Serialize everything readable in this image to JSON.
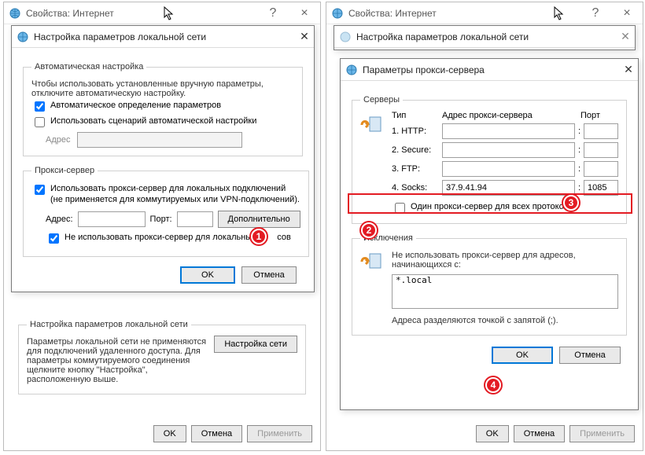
{
  "left": {
    "parentTitle": "Свойства: Интернет",
    "lanTitle": "Настройка параметров локальной сети",
    "auto": {
      "legend": "Автоматическая настройка",
      "desc": "Чтобы использовать установленные вручную параметры, отключите автоматическую настройку.",
      "autoDetect": "Автоматическое определение параметров",
      "useScript": "Использовать сценарий автоматической настройки",
      "addressLabel": "Адрес"
    },
    "proxy": {
      "legend": "Прокси-сервер",
      "useProxy": "Использовать прокси-сервер для локальных подключений (не применяется для коммутируемых или VPN-подключений).",
      "addressLabel": "Адрес:",
      "addressValue": "",
      "portLabel": "Порт:",
      "portValue": "",
      "advancedBtn": "Дополнительно",
      "bypassLocal": "Не использовать прокси-сервер для локальны",
      "bypassLocalSuffix": "сов"
    },
    "okBtn": "OK",
    "cancelBtn": "Отмена",
    "lanPanel": {
      "legend": "Настройка параметров локальной сети",
      "desc": "Параметры локальной сети не применяются для подключений удаленного доступа. Для параметры коммутируемого соединения щелкните кнопку \"Настройка\", расположенную выше.",
      "netSettingsBtn": "Настройка сети"
    },
    "applyBtn": "Применить"
  },
  "right": {
    "parentTitle": "Свойства: Интернет",
    "lanTitle": "Настройка параметров локальной сети",
    "proxyTitle": "Параметры прокси-сервера",
    "servers": {
      "legend": "Серверы",
      "typeHdr": "Тип",
      "addrHdr": "Адрес прокси-сервера",
      "portHdr": "Порт",
      "rows": [
        {
          "label": "1. HTTP:",
          "addr": "",
          "port": ""
        },
        {
          "label": "2. Secure:",
          "addr": "",
          "port": ""
        },
        {
          "label": "3. FTP:",
          "addr": "",
          "port": ""
        },
        {
          "label": "4. Socks:",
          "addr": "37.9.41.94",
          "port": "1085"
        }
      ],
      "sameForAll": "Один прокси-сервер для всех протоколов"
    },
    "exceptions": {
      "legend": "Исключения",
      "desc": "Не использовать прокси-сервер для адресов, начинающихся с:",
      "value": "*.local",
      "note": "Адреса разделяются точкой с запятой (;)."
    },
    "okBtn": "OK",
    "cancelBtn": "Отмена",
    "applyBtn": "Применить"
  }
}
